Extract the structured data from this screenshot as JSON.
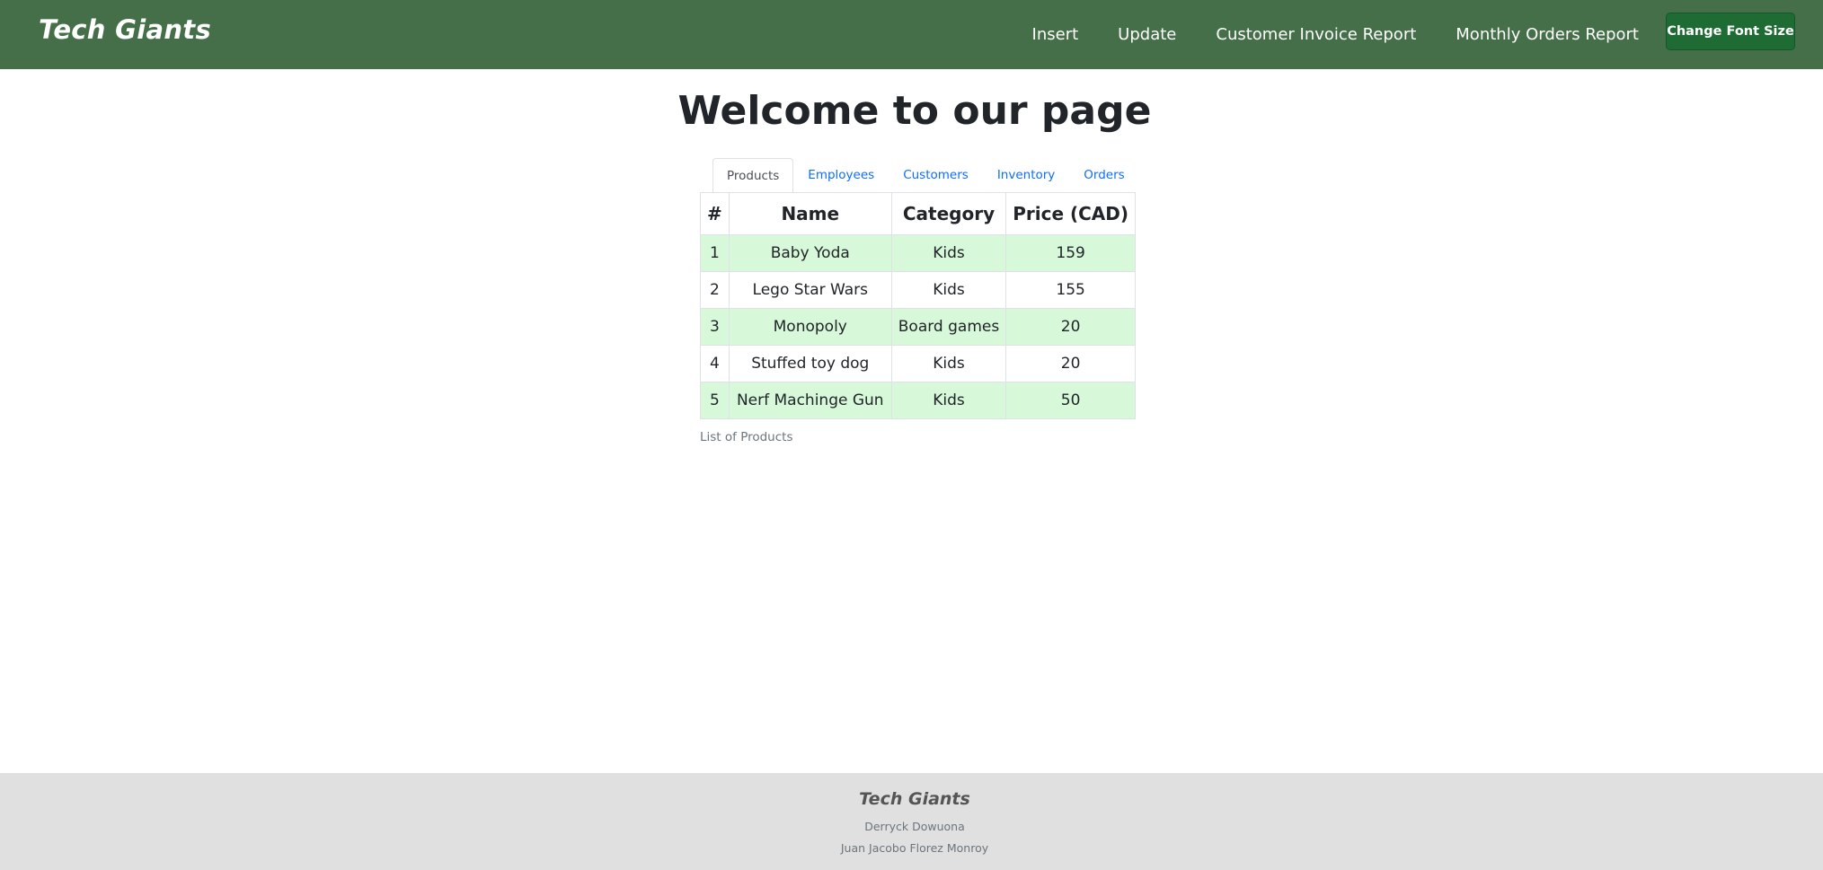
{
  "navbar": {
    "brand": "Tech Giants",
    "links": [
      "Insert",
      "Update",
      "Customer Invoice Report",
      "Monthly Orders Report"
    ],
    "font_button_label": "Change Font Size",
    "background_color": "#446f48",
    "button_color": "#1f6b34"
  },
  "main": {
    "title": "Welcome to our page",
    "tabs": [
      {
        "label": "Products",
        "active": true
      },
      {
        "label": "Employees",
        "active": false
      },
      {
        "label": "Customers",
        "active": false
      },
      {
        "label": "Inventory",
        "active": false
      },
      {
        "label": "Orders",
        "active": false
      }
    ],
    "table": {
      "headers": [
        "#",
        "Name",
        "Category",
        "Price (CAD)"
      ],
      "rows": [
        [
          "1",
          "Baby Yoda",
          "Kids",
          "159"
        ],
        [
          "2",
          "Lego Star Wars",
          "Kids",
          "155"
        ],
        [
          "3",
          "Monopoly",
          "Board games",
          "20"
        ],
        [
          "4",
          "Stuffed toy dog",
          "Kids",
          "20"
        ],
        [
          "5",
          "Nerf Machinge Gun",
          "Kids",
          "50"
        ]
      ],
      "caption": "List of Products",
      "row_highlight_color": "#d7f9da"
    }
  },
  "footer": {
    "brand": "Tech Giants",
    "authors": [
      "Derryck Dowuona",
      "Juan Jacobo Florez Monroy"
    ]
  }
}
